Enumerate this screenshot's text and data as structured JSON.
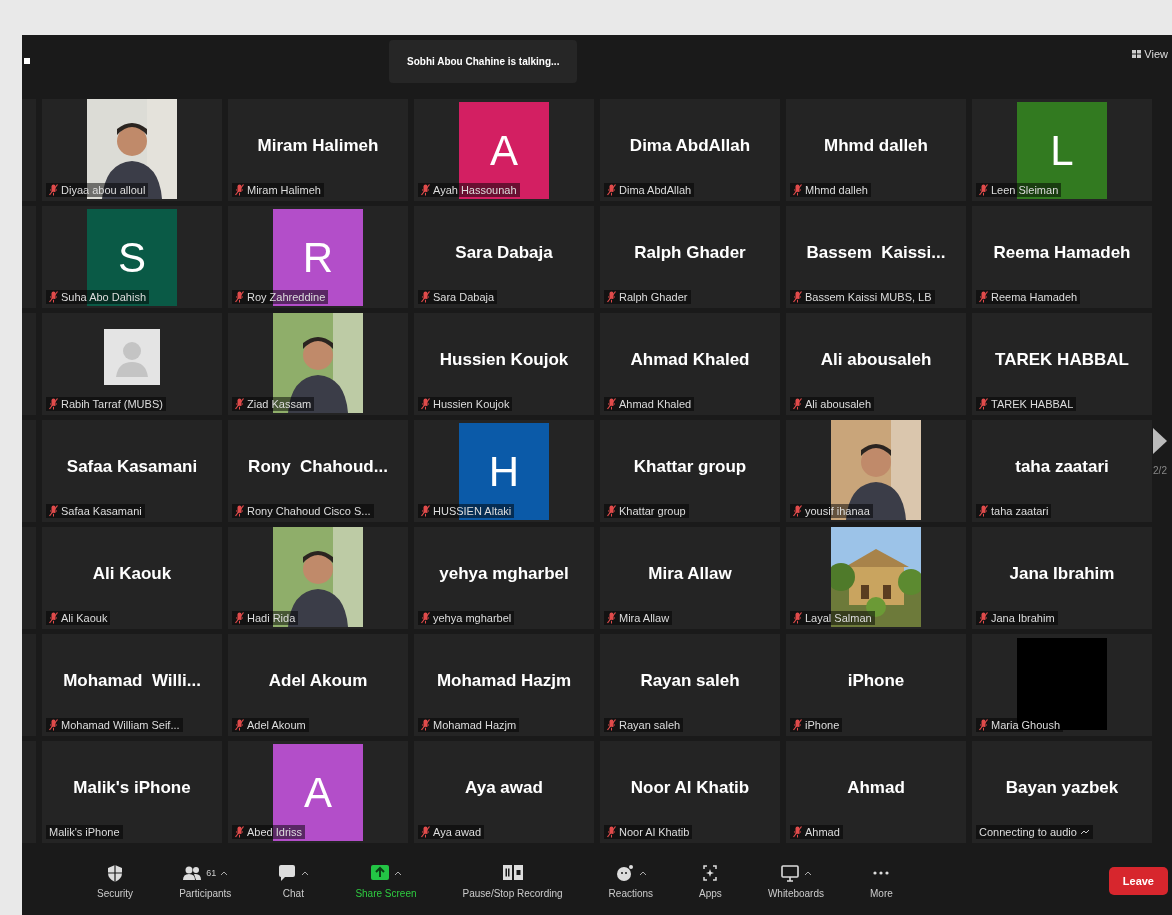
{
  "top_bar": {
    "speaker_banner": "Sobhi Abou Chahine is talking...",
    "view_button": "View"
  },
  "tiles": [
    {
      "kind": "picture",
      "label": "Diyaa abou alloul",
      "muted": true
    },
    {
      "kind": "name",
      "title": "Miram Halimeh",
      "label": "Miram Halimeh",
      "muted": true
    },
    {
      "kind": "avatar",
      "initial": "A",
      "color": "#d31f62",
      "label": "Ayah Hassounah",
      "muted": true
    },
    {
      "kind": "name",
      "title": "Dima AbdAllah",
      "label": "Dima AbdAllah",
      "muted": true
    },
    {
      "kind": "name",
      "title": "Mhmd dalleh",
      "label": "Mhmd dalleh",
      "muted": true
    },
    {
      "kind": "avatar",
      "initial": "L",
      "color": "#327a20",
      "label": "Leen Sleiman",
      "muted": true
    },
    {
      "kind": "avatar",
      "initial": "S",
      "color": "#0a5a46",
      "label": "Suha Abo Dahish",
      "muted": true
    },
    {
      "kind": "avatar",
      "initial": "R",
      "color": "#b34ec9",
      "label": "Roy Zahreddine",
      "muted": true
    },
    {
      "kind": "name",
      "title": "Sara Dabaja",
      "label": "Sara Dabaja",
      "muted": true
    },
    {
      "kind": "name",
      "title": "Ralph Ghader",
      "label": "Ralph Ghader",
      "muted": true
    },
    {
      "kind": "name",
      "title": "Bassem  Kaissi...",
      "label": "Bassem Kaissi MUBS, LB",
      "muted": true
    },
    {
      "kind": "name",
      "title": "Reema Hamadeh",
      "label": "Reema Hamadeh",
      "muted": true
    },
    {
      "kind": "placeholder",
      "label": "Rabih Tarraf (MUBS)",
      "muted": true
    },
    {
      "kind": "picture",
      "label": "Ziad Kassam",
      "muted": true
    },
    {
      "kind": "name",
      "title": "Hussien Koujok",
      "label": "Hussien Koujok",
      "muted": true
    },
    {
      "kind": "name",
      "title": "Ahmad Khaled",
      "label": "Ahmad Khaled",
      "muted": true
    },
    {
      "kind": "name",
      "title": "Ali abousaleh",
      "label": "Ali abousaleh",
      "muted": true
    },
    {
      "kind": "name",
      "title": "TAREK HABBAL",
      "label": "TAREK HABBAL",
      "muted": true
    },
    {
      "kind": "name",
      "title": "Safaa Kasamani",
      "label": "Safaa Kasamani",
      "muted": true
    },
    {
      "kind": "name",
      "title": "Rony  Chahoud...",
      "label": "Rony Chahoud Cisco S...",
      "muted": true
    },
    {
      "kind": "avatar",
      "initial": "H",
      "color": "#0b5aa8",
      "label": "HUSSIEN Altaki",
      "muted": true
    },
    {
      "kind": "name",
      "title": "Khattar group",
      "label": "Khattar group",
      "muted": true
    },
    {
      "kind": "picture",
      "label": "yousif ihanaa",
      "muted": true
    },
    {
      "kind": "name",
      "title": "taha zaatari",
      "label": "taha zaatari",
      "muted": true
    },
    {
      "kind": "name",
      "title": "Ali Kaouk",
      "label": "Ali Kaouk",
      "muted": true
    },
    {
      "kind": "picture",
      "label": "Hadi Rida",
      "muted": true
    },
    {
      "kind": "name",
      "title": "yehya mgharbel",
      "label": "yehya mgharbel",
      "muted": true
    },
    {
      "kind": "name",
      "title": "Mira Allaw",
      "label": "Mira Allaw",
      "muted": true
    },
    {
      "kind": "picture",
      "label": "Layal Salman",
      "muted": true
    },
    {
      "kind": "name",
      "title": "Jana Ibrahim",
      "label": "Jana Ibrahim",
      "muted": true
    },
    {
      "kind": "name",
      "title": "Mohamad  Willi...",
      "label": "Mohamad William Seif...",
      "muted": true
    },
    {
      "kind": "name",
      "title": "Adel Akoum",
      "label": "Adel Akoum",
      "muted": true
    },
    {
      "kind": "name",
      "title": "Mohamad Hazjm",
      "label": "Mohamad Hazjm",
      "muted": true
    },
    {
      "kind": "name",
      "title": "Rayan saleh",
      "label": "Rayan saleh",
      "muted": true
    },
    {
      "kind": "name",
      "title": "iPhone",
      "label": "iPhone",
      "muted": true
    },
    {
      "kind": "blank_video",
      "label": "Maria Ghoush",
      "muted": true
    },
    {
      "kind": "name",
      "title": "Malik's iPhone",
      "label": "Malik's iPhone",
      "muted": false
    },
    {
      "kind": "avatar",
      "initial": "A",
      "color": "#b34ec9",
      "label": "Abed Idriss",
      "muted": true
    },
    {
      "kind": "name",
      "title": "Aya awad",
      "label": "Aya awad",
      "muted": true
    },
    {
      "kind": "name",
      "title": "Noor Al Khatib",
      "label": "Noor Al Khatib",
      "muted": true
    },
    {
      "kind": "name",
      "title": "Ahmad",
      "label": "Ahmad",
      "muted": true
    },
    {
      "kind": "name",
      "title": "Bayan yazbek",
      "label": "Connecting to audio",
      "muted": false,
      "connecting": true
    }
  ],
  "pager": {
    "label": "2/2"
  },
  "toolbar": {
    "items": [
      {
        "kind": "shield",
        "label": "Security",
        "has_menu": false
      },
      {
        "kind": "people",
        "label": "Participants",
        "count": "61",
        "has_menu": true
      },
      {
        "kind": "chat",
        "label": "Chat",
        "has_menu": true
      },
      {
        "kind": "share",
        "label": "Share Screen",
        "has_menu": true
      },
      {
        "kind": "record",
        "label": "Pause/Stop Recording",
        "has_menu": false
      },
      {
        "kind": "reactions",
        "label": "Reactions",
        "has_menu": true
      },
      {
        "kind": "apps",
        "label": "Apps",
        "has_menu": false
      },
      {
        "kind": "whiteboard",
        "label": "Whiteboards",
        "has_menu": true
      },
      {
        "kind": "more",
        "label": "More",
        "has_menu": false
      }
    ],
    "leave": "Leave"
  }
}
